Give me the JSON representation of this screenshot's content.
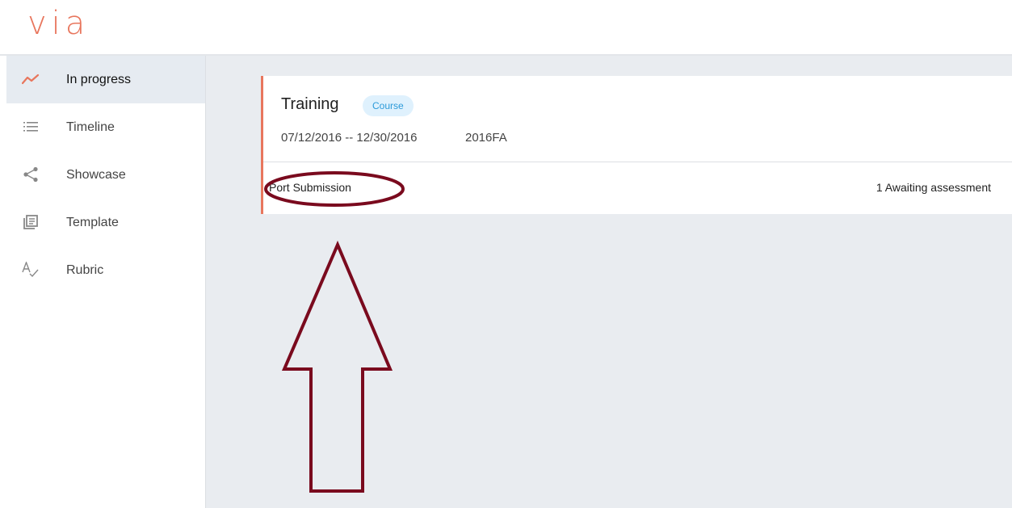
{
  "app": {
    "logo": "via"
  },
  "sidebar": {
    "items": [
      {
        "label": "In progress",
        "icon": "trend-line-icon",
        "active": true
      },
      {
        "label": "Timeline",
        "icon": "list-icon",
        "active": false
      },
      {
        "label": "Showcase",
        "icon": "share-icon",
        "active": false
      },
      {
        "label": "Template",
        "icon": "template-icon",
        "active": false
      },
      {
        "label": "Rubric",
        "icon": "rubric-icon",
        "active": false
      }
    ]
  },
  "card": {
    "title": "Training",
    "badge": "Course",
    "dates": "07/12/2016 -- 12/30/2016",
    "term": "2016FA",
    "link": "Port Submission",
    "status": "1 Awaiting assessment"
  },
  "colors": {
    "accent": "#e8765d",
    "badge_bg": "#dff1fd",
    "badge_text": "#2d9bd9",
    "annotation": "#7a0a1e",
    "main_bg": "#e9ecf0"
  }
}
